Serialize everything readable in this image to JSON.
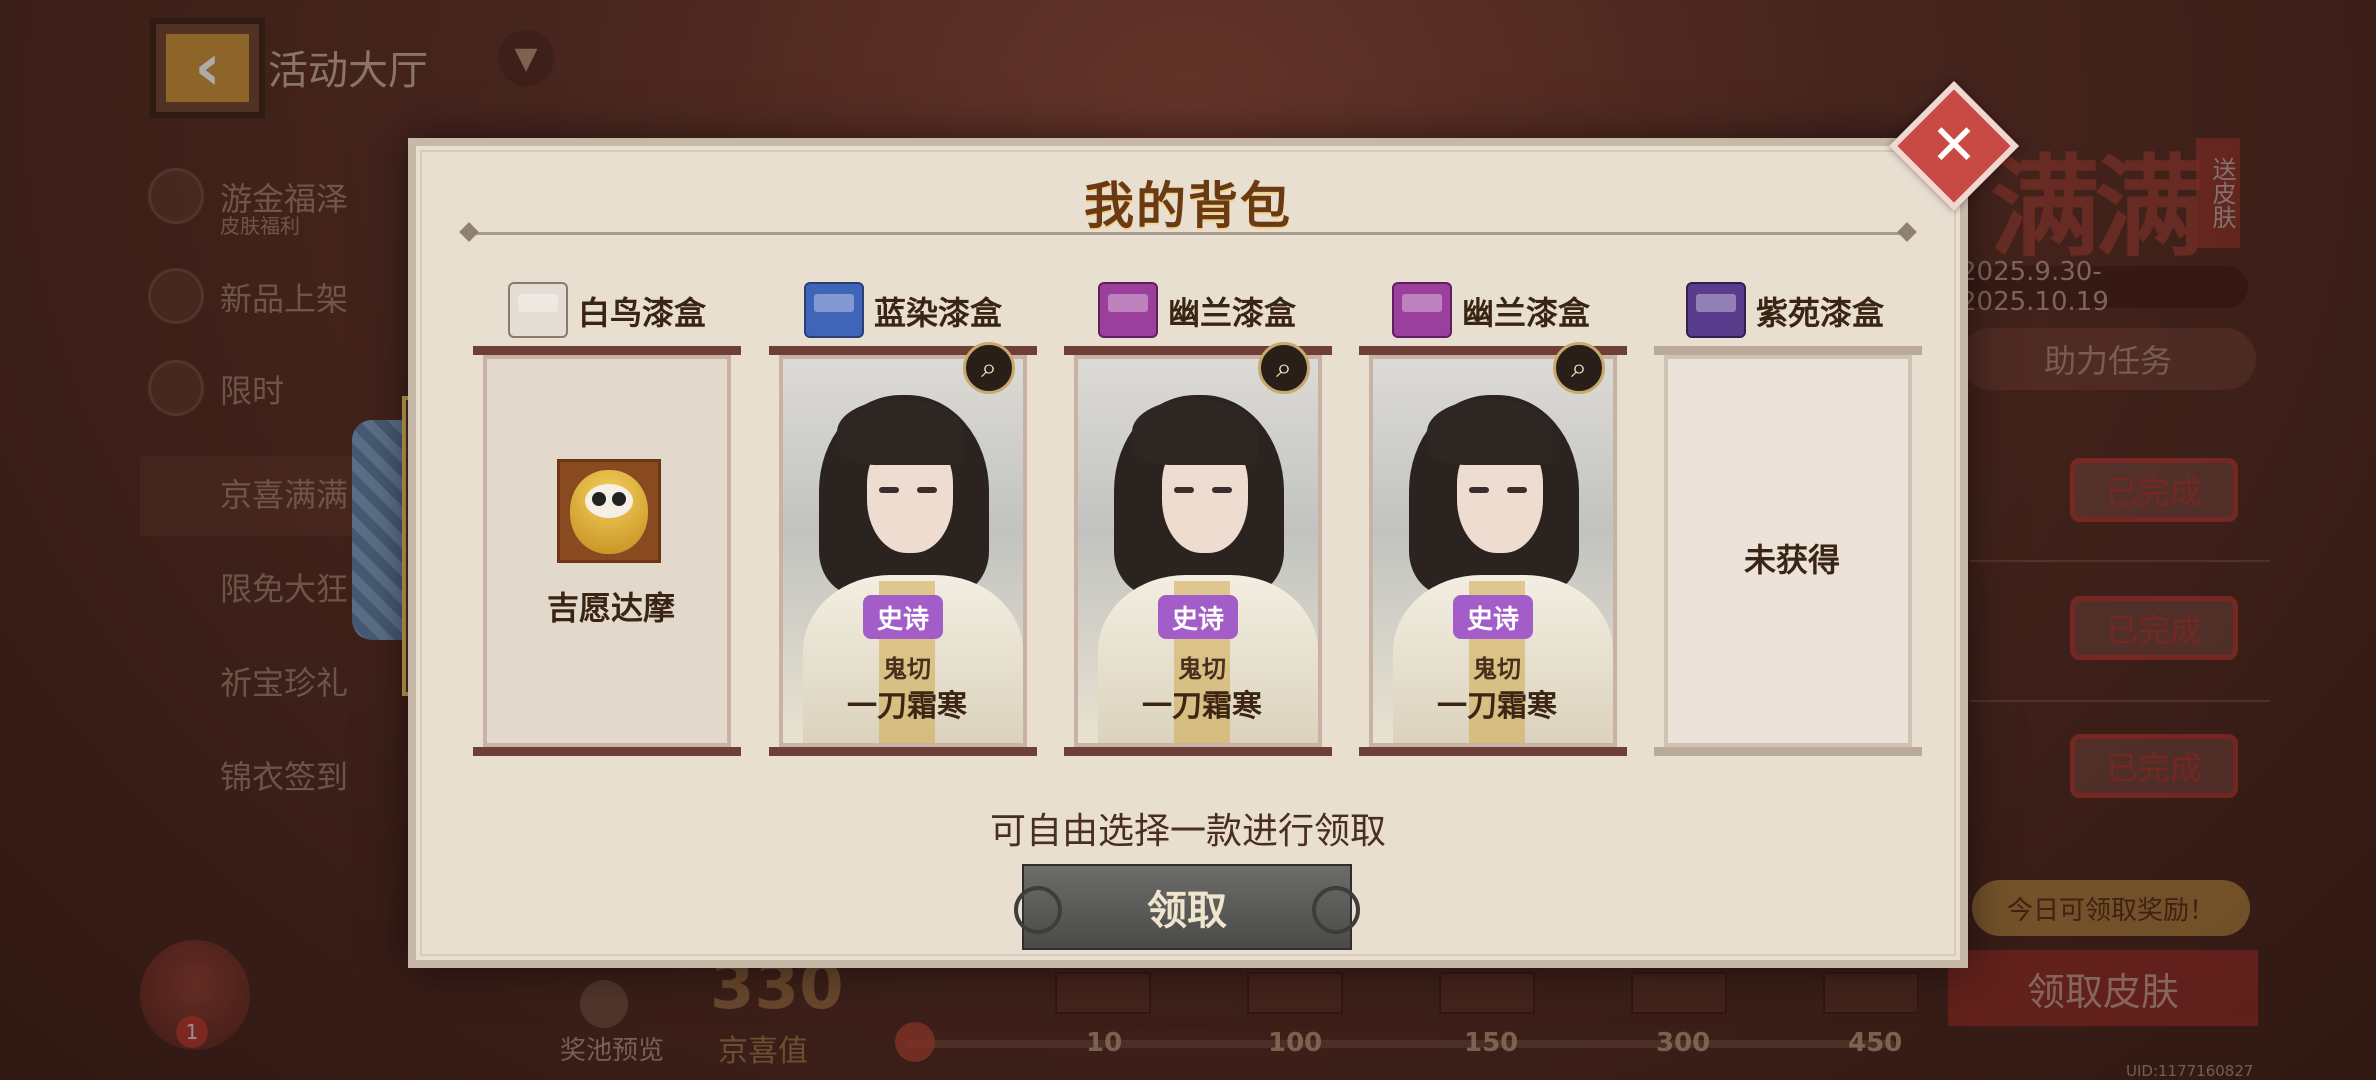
{
  "header": {
    "title": "活动大厅"
  },
  "sidebar": {
    "items": [
      {
        "label": "游金福泽",
        "sub": "皮肤福利"
      },
      {
        "label": "新品上架"
      },
      {
        "label": "限时"
      },
      {
        "label": "京喜满满"
      },
      {
        "label": "限免大狂"
      },
      {
        "label": "祈宝珍礼"
      },
      {
        "label": "锦衣签到"
      }
    ]
  },
  "event": {
    "title": "满满",
    "tag": "送皮肤",
    "date": "2025.9.30-2025.10.19",
    "help_task": "助力任务",
    "done_labels": [
      "已完成",
      "已完成",
      "已完成"
    ],
    "today_tip": "今日可领取奖励！",
    "claim_skin": "领取皮肤",
    "uid": "UID:1177160827"
  },
  "bottom": {
    "pool_preview": "奖池预览",
    "score": "330",
    "score_label": "京喜值",
    "ticks": [
      "10",
      "100",
      "150",
      "300",
      "450"
    ]
  },
  "modal": {
    "title": "我的背包",
    "slots": [
      {
        "box": "白鸟漆盒",
        "state": "item",
        "item": "吉愿达摩",
        "box_color": "#e3ddd3"
      },
      {
        "box": "蓝染漆盒",
        "state": "skin",
        "rarity": "史诗",
        "character": "鬼切",
        "skin": "一刀霜寒",
        "box_color": "#3f64b8"
      },
      {
        "box": "幽兰漆盒",
        "state": "skin",
        "rarity": "史诗",
        "character": "鬼切",
        "skin": "一刀霜寒",
        "box_color": "#9a3f9c"
      },
      {
        "box": "幽兰漆盒",
        "state": "skin",
        "rarity": "史诗",
        "character": "鬼切",
        "skin": "一刀霜寒",
        "box_color": "#9a3f9c"
      },
      {
        "box": "紫苑漆盒",
        "state": "none",
        "status": "未获得",
        "box_color": "#5a3c8c"
      }
    ],
    "hint": "可自由选择一款进行领取",
    "claim_button": "领取",
    "close_icon": "close-icon"
  },
  "colors": {
    "rarity_epic": "#a25dc9",
    "accent_red": "#c94a45"
  }
}
